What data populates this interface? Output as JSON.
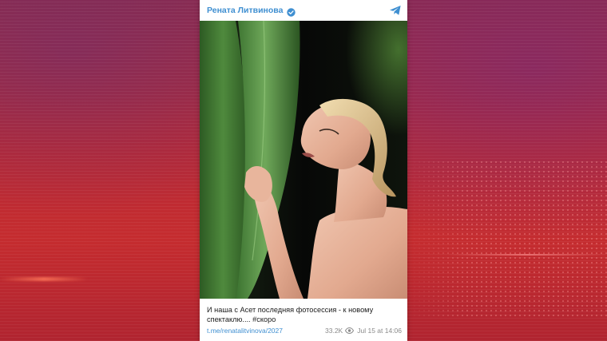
{
  "post": {
    "channel_name": "Рената Литвинова",
    "caption": "И наша с Асет последняя фотосессия - к новому спектаклю.... #скоро",
    "link": "t.me/renatalitvinova/2027",
    "views": "33.2K",
    "datetime": "Jul 15 at 14:06"
  },
  "icons": {
    "verified": "verified-check-icon",
    "share": "telegram-share-icon",
    "views": "eye-icon"
  },
  "colors": {
    "accent": "#3f8fd1",
    "background_red": "#c52c2f"
  }
}
